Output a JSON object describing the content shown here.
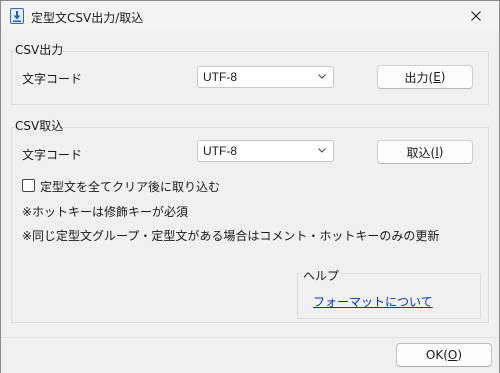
{
  "window": {
    "title": "定型文CSV出力/取込"
  },
  "export_group": {
    "title": "CSV出力",
    "char_code_label": "文字コード",
    "char_code_value": "UTF-8",
    "button_label": "出力(",
    "button_key": "E",
    "button_suffix": ")"
  },
  "import_group": {
    "title": "CSV取込",
    "char_code_label": "文字コード",
    "char_code_value": "UTF-8",
    "button_label": "取込(",
    "button_key": "I",
    "button_suffix": ")",
    "clear_checkbox_label": "定型文を全てクリア後に取り込む",
    "clear_checkbox_checked": false,
    "note_1": "※ホットキーは修飾キーが必須",
    "note_2": "※同じ定型文グループ・定型文がある場合はコメント・ホットキーのみの更新"
  },
  "help": {
    "title": "ヘルプ",
    "link": "フォーマットについて"
  },
  "footer": {
    "ok_label": "OK(",
    "ok_key": "O",
    "ok_suffix": ")"
  },
  "colors": {
    "link": "#0033cc",
    "background": "#f0f0f0"
  },
  "icons": {
    "app": "download-arrow-icon",
    "close": "close-icon",
    "combo": "chevron-down-icon"
  }
}
